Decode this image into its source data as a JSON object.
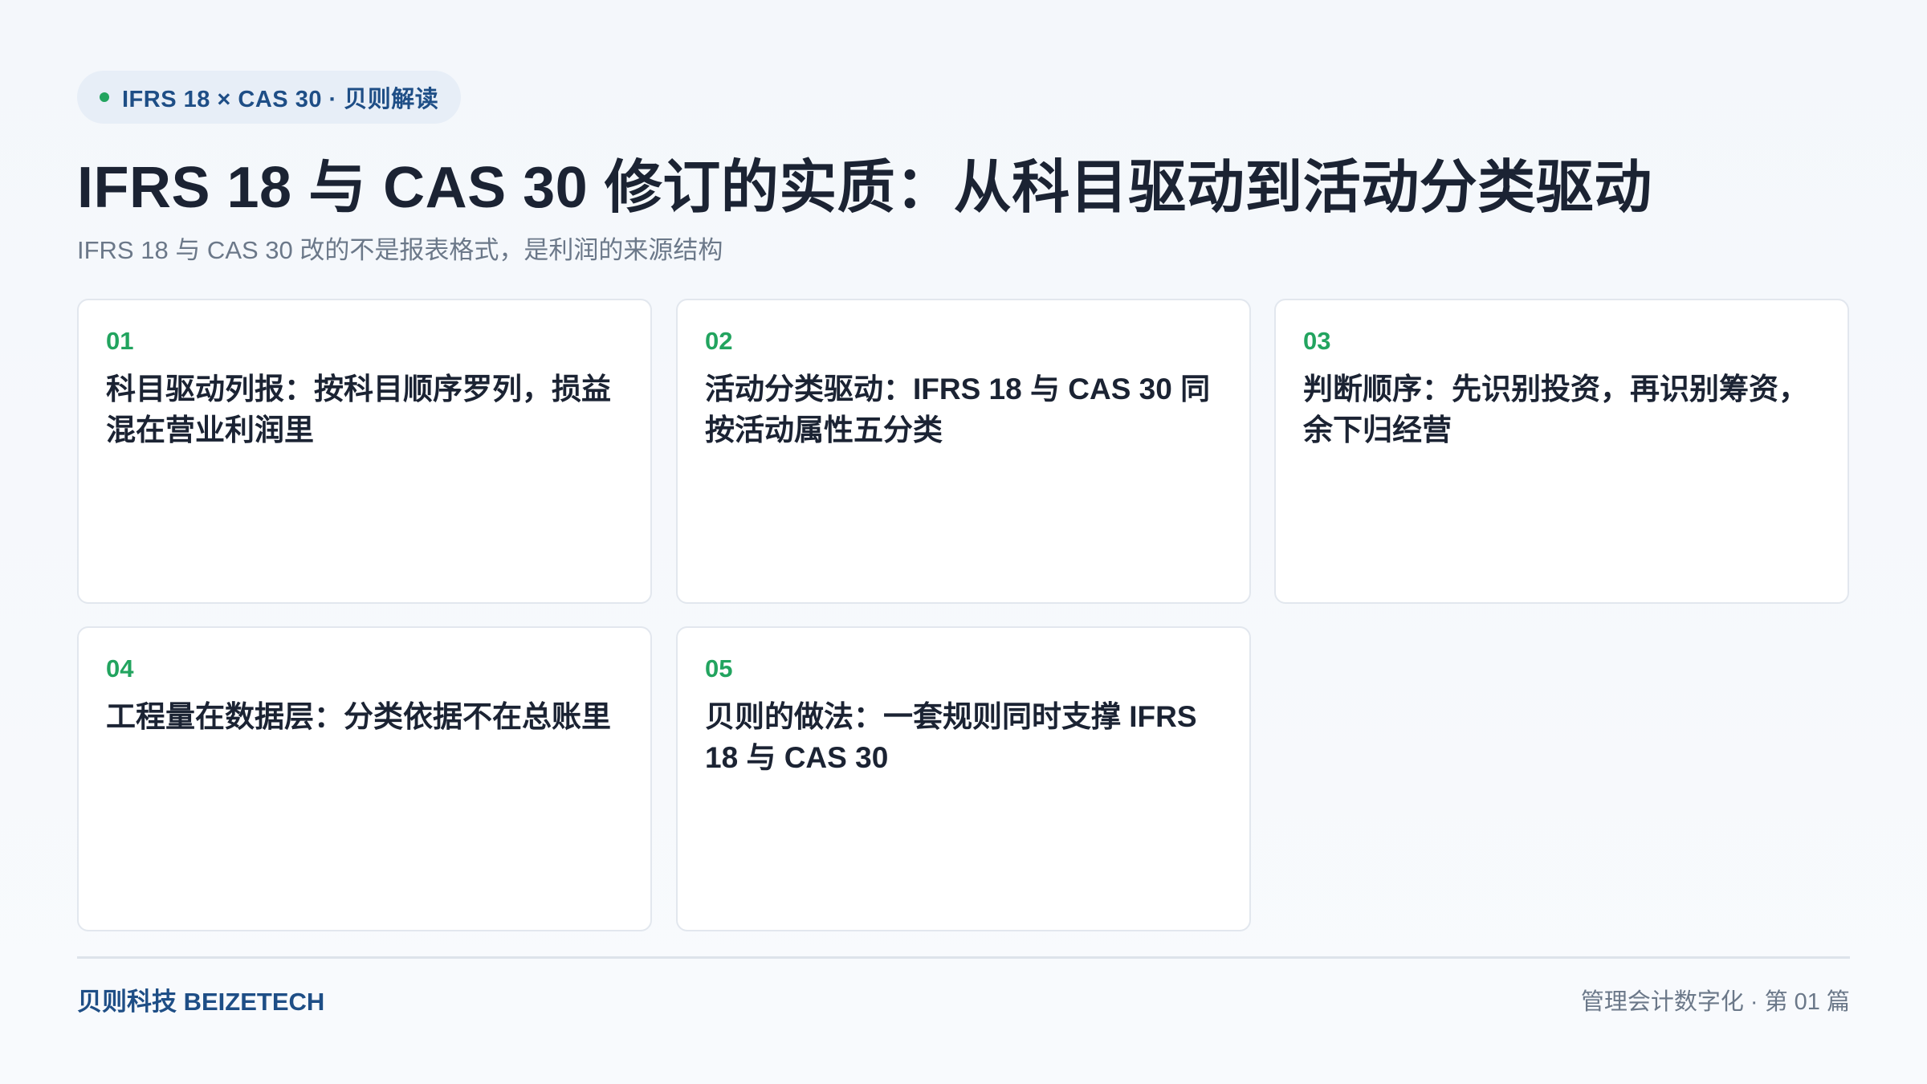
{
  "header": {
    "tag": "IFRS 18 × CAS 30 · 贝则解读",
    "title": "IFRS 18 与 CAS 30 修订的实质：从科目驱动到活动分类驱动",
    "subtitle": "IFRS 18 与 CAS 30 改的不是报表格式，是利润的来源结构"
  },
  "cards": [
    {
      "num": "01",
      "text": "科目驱动列报：按科目顺序罗列，损益混在营业利润里"
    },
    {
      "num": "02",
      "text": "活动分类驱动：IFRS 18 与 CAS 30 同按活动属性五分类"
    },
    {
      "num": "03",
      "text": "判断顺序：先识别投资，再识别筹资，余下归经营"
    },
    {
      "num": "04",
      "text": "工程量在数据层：分类依据不在总账里"
    },
    {
      "num": "05",
      "text": "贝则的做法：一套规则同时支撑 IFRS 18 与 CAS 30"
    }
  ],
  "footer": {
    "brand": "贝则科技 BEIZETECH",
    "series": "管理会计数字化 · 第 01 篇"
  },
  "colors": {
    "accent_green": "#22a45f",
    "brand_blue": "#1e4e86",
    "text_dark": "#1b2333",
    "text_muted": "#6b7889"
  }
}
